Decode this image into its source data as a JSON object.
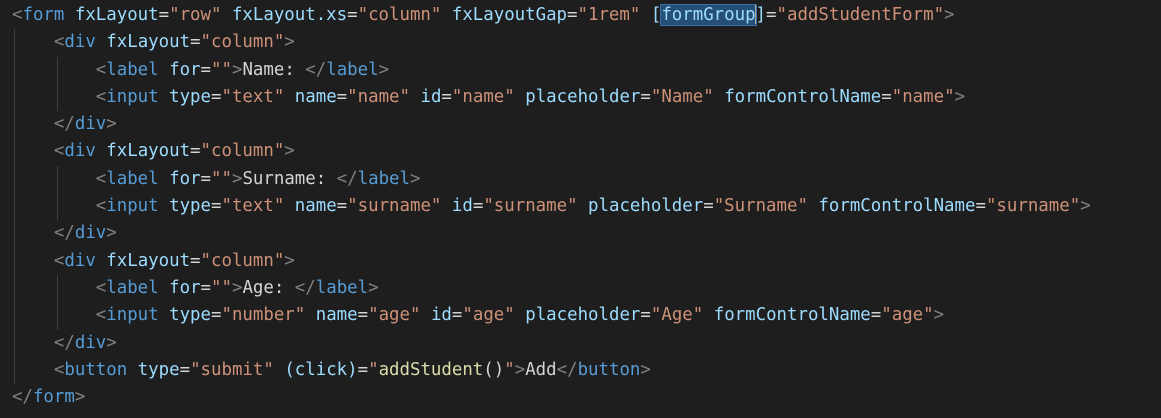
{
  "editor": {
    "lines": [
      {
        "indent": "",
        "tokens": [
          {
            "t": "brk",
            "v": "<"
          },
          {
            "t": "tag",
            "v": "form"
          },
          {
            "t": "txt",
            "v": " "
          },
          {
            "t": "attr",
            "v": "fxLayout"
          },
          {
            "t": "txt",
            "v": "="
          },
          {
            "t": "str",
            "v": "\"row\""
          },
          {
            "t": "txt",
            "v": " "
          },
          {
            "t": "attr",
            "v": "fxLayout.xs"
          },
          {
            "t": "txt",
            "v": "="
          },
          {
            "t": "str",
            "v": "\"column\""
          },
          {
            "t": "txt",
            "v": " "
          },
          {
            "t": "attr",
            "v": "fxLayoutGap"
          },
          {
            "t": "txt",
            "v": "="
          },
          {
            "t": "str",
            "v": "\"1rem\""
          },
          {
            "t": "txt",
            "v": " "
          },
          {
            "t": "attr",
            "v": "["
          },
          {
            "t": "attr",
            "v": "formGroup",
            "sel": true
          },
          {
            "t": "cursor",
            "v": ""
          },
          {
            "t": "attr",
            "v": "]"
          },
          {
            "t": "txt",
            "v": "="
          },
          {
            "t": "str",
            "v": "\"addStudentForm\""
          },
          {
            "t": "brk",
            "v": ">"
          }
        ]
      },
      {
        "indent": "    ",
        "tokens": [
          {
            "t": "brk",
            "v": "<"
          },
          {
            "t": "tag",
            "v": "div"
          },
          {
            "t": "txt",
            "v": " "
          },
          {
            "t": "attr",
            "v": "fxLayout"
          },
          {
            "t": "txt",
            "v": "="
          },
          {
            "t": "str",
            "v": "\"column\""
          },
          {
            "t": "brk",
            "v": ">"
          }
        ]
      },
      {
        "indent": "        ",
        "tokens": [
          {
            "t": "brk",
            "v": "<"
          },
          {
            "t": "tag",
            "v": "label"
          },
          {
            "t": "txt",
            "v": " "
          },
          {
            "t": "attr",
            "v": "for"
          },
          {
            "t": "txt",
            "v": "="
          },
          {
            "t": "str",
            "v": "\"\""
          },
          {
            "t": "brk",
            "v": ">"
          },
          {
            "t": "txt",
            "v": "Name: "
          },
          {
            "t": "brk",
            "v": "</"
          },
          {
            "t": "tag",
            "v": "label"
          },
          {
            "t": "brk",
            "v": ">"
          }
        ]
      },
      {
        "indent": "        ",
        "tokens": [
          {
            "t": "brk",
            "v": "<"
          },
          {
            "t": "tag",
            "v": "input"
          },
          {
            "t": "txt",
            "v": " "
          },
          {
            "t": "attr",
            "v": "type"
          },
          {
            "t": "txt",
            "v": "="
          },
          {
            "t": "str",
            "v": "\"text\""
          },
          {
            "t": "txt",
            "v": " "
          },
          {
            "t": "attr",
            "v": "name"
          },
          {
            "t": "txt",
            "v": "="
          },
          {
            "t": "str",
            "v": "\"name\""
          },
          {
            "t": "txt",
            "v": " "
          },
          {
            "t": "attr",
            "v": "id"
          },
          {
            "t": "txt",
            "v": "="
          },
          {
            "t": "str",
            "v": "\"name\""
          },
          {
            "t": "txt",
            "v": " "
          },
          {
            "t": "attr",
            "v": "placeholder"
          },
          {
            "t": "txt",
            "v": "="
          },
          {
            "t": "str",
            "v": "\"Name\""
          },
          {
            "t": "txt",
            "v": " "
          },
          {
            "t": "attr",
            "v": "formControlName"
          },
          {
            "t": "txt",
            "v": "="
          },
          {
            "t": "str",
            "v": "\"name\""
          },
          {
            "t": "brk",
            "v": ">"
          }
        ]
      },
      {
        "indent": "    ",
        "tokens": [
          {
            "t": "brk",
            "v": "</"
          },
          {
            "t": "tag",
            "v": "div"
          },
          {
            "t": "brk",
            "v": ">"
          }
        ]
      },
      {
        "indent": "    ",
        "tokens": [
          {
            "t": "brk",
            "v": "<"
          },
          {
            "t": "tag",
            "v": "div"
          },
          {
            "t": "txt",
            "v": " "
          },
          {
            "t": "attr",
            "v": "fxLayout"
          },
          {
            "t": "txt",
            "v": "="
          },
          {
            "t": "str",
            "v": "\"column\""
          },
          {
            "t": "brk",
            "v": ">"
          }
        ]
      },
      {
        "indent": "        ",
        "tokens": [
          {
            "t": "brk",
            "v": "<"
          },
          {
            "t": "tag",
            "v": "label"
          },
          {
            "t": "txt",
            "v": " "
          },
          {
            "t": "attr",
            "v": "for"
          },
          {
            "t": "txt",
            "v": "="
          },
          {
            "t": "str",
            "v": "\"\""
          },
          {
            "t": "brk",
            "v": ">"
          },
          {
            "t": "txt",
            "v": "Surname: "
          },
          {
            "t": "brk",
            "v": "</"
          },
          {
            "t": "tag",
            "v": "label"
          },
          {
            "t": "brk",
            "v": ">"
          }
        ]
      },
      {
        "indent": "        ",
        "tokens": [
          {
            "t": "brk",
            "v": "<"
          },
          {
            "t": "tag",
            "v": "input"
          },
          {
            "t": "txt",
            "v": " "
          },
          {
            "t": "attr",
            "v": "type"
          },
          {
            "t": "txt",
            "v": "="
          },
          {
            "t": "str",
            "v": "\"text\""
          },
          {
            "t": "txt",
            "v": " "
          },
          {
            "t": "attr",
            "v": "name"
          },
          {
            "t": "txt",
            "v": "="
          },
          {
            "t": "str",
            "v": "\"surname\""
          },
          {
            "t": "txt",
            "v": " "
          },
          {
            "t": "attr",
            "v": "id"
          },
          {
            "t": "txt",
            "v": "="
          },
          {
            "t": "str",
            "v": "\"surname\""
          },
          {
            "t": "txt",
            "v": " "
          },
          {
            "t": "attr",
            "v": "placeholder"
          },
          {
            "t": "txt",
            "v": "="
          },
          {
            "t": "str",
            "v": "\"Surname\""
          },
          {
            "t": "txt",
            "v": " "
          },
          {
            "t": "attr",
            "v": "formControlName"
          },
          {
            "t": "txt",
            "v": "="
          },
          {
            "t": "str",
            "v": "\"surname\""
          },
          {
            "t": "brk",
            "v": ">"
          }
        ]
      },
      {
        "indent": "    ",
        "tokens": [
          {
            "t": "brk",
            "v": "</"
          },
          {
            "t": "tag",
            "v": "div"
          },
          {
            "t": "brk",
            "v": ">"
          }
        ]
      },
      {
        "indent": "    ",
        "tokens": [
          {
            "t": "brk",
            "v": "<"
          },
          {
            "t": "tag",
            "v": "div"
          },
          {
            "t": "txt",
            "v": " "
          },
          {
            "t": "attr",
            "v": "fxLayout"
          },
          {
            "t": "txt",
            "v": "="
          },
          {
            "t": "str",
            "v": "\"column\""
          },
          {
            "t": "brk",
            "v": ">"
          }
        ]
      },
      {
        "indent": "        ",
        "tokens": [
          {
            "t": "brk",
            "v": "<"
          },
          {
            "t": "tag",
            "v": "label"
          },
          {
            "t": "txt",
            "v": " "
          },
          {
            "t": "attr",
            "v": "for"
          },
          {
            "t": "txt",
            "v": "="
          },
          {
            "t": "str",
            "v": "\"\""
          },
          {
            "t": "brk",
            "v": ">"
          },
          {
            "t": "txt",
            "v": "Age: "
          },
          {
            "t": "brk",
            "v": "</"
          },
          {
            "t": "tag",
            "v": "label"
          },
          {
            "t": "brk",
            "v": ">"
          }
        ]
      },
      {
        "indent": "        ",
        "tokens": [
          {
            "t": "brk",
            "v": "<"
          },
          {
            "t": "tag",
            "v": "input"
          },
          {
            "t": "txt",
            "v": " "
          },
          {
            "t": "attr",
            "v": "type"
          },
          {
            "t": "txt",
            "v": "="
          },
          {
            "t": "str",
            "v": "\"number\""
          },
          {
            "t": "txt",
            "v": " "
          },
          {
            "t": "attr",
            "v": "name"
          },
          {
            "t": "txt",
            "v": "="
          },
          {
            "t": "str",
            "v": "\"age\""
          },
          {
            "t": "txt",
            "v": " "
          },
          {
            "t": "attr",
            "v": "id"
          },
          {
            "t": "txt",
            "v": "="
          },
          {
            "t": "str",
            "v": "\"age\""
          },
          {
            "t": "txt",
            "v": " "
          },
          {
            "t": "attr",
            "v": "placeholder"
          },
          {
            "t": "txt",
            "v": "="
          },
          {
            "t": "str",
            "v": "\"Age\""
          },
          {
            "t": "txt",
            "v": " "
          },
          {
            "t": "attr",
            "v": "formControlName"
          },
          {
            "t": "txt",
            "v": "="
          },
          {
            "t": "str",
            "v": "\"age\""
          },
          {
            "t": "brk",
            "v": ">"
          }
        ]
      },
      {
        "indent": "    ",
        "tokens": [
          {
            "t": "brk",
            "v": "</"
          },
          {
            "t": "tag",
            "v": "div"
          },
          {
            "t": "brk",
            "v": ">"
          }
        ]
      },
      {
        "indent": "    ",
        "tokens": [
          {
            "t": "brk",
            "v": "<"
          },
          {
            "t": "tag",
            "v": "button"
          },
          {
            "t": "txt",
            "v": " "
          },
          {
            "t": "attr",
            "v": "type"
          },
          {
            "t": "txt",
            "v": "="
          },
          {
            "t": "str",
            "v": "\"submit\""
          },
          {
            "t": "txt",
            "v": " "
          },
          {
            "t": "attr",
            "v": "(click)"
          },
          {
            "t": "txt",
            "v": "="
          },
          {
            "t": "str",
            "v": "\""
          },
          {
            "t": "fn",
            "v": "addStudent"
          },
          {
            "t": "txt",
            "v": "()"
          },
          {
            "t": "str",
            "v": "\""
          },
          {
            "t": "brk",
            "v": ">"
          },
          {
            "t": "txt",
            "v": "Add"
          },
          {
            "t": "brk",
            "v": "</"
          },
          {
            "t": "tag",
            "v": "button"
          },
          {
            "t": "brk",
            "v": ">"
          }
        ]
      },
      {
        "indent": "",
        "tokens": [
          {
            "t": "brk",
            "v": "</"
          },
          {
            "t": "tag",
            "v": "form"
          },
          {
            "t": "brk",
            "v": ">"
          }
        ]
      }
    ]
  }
}
